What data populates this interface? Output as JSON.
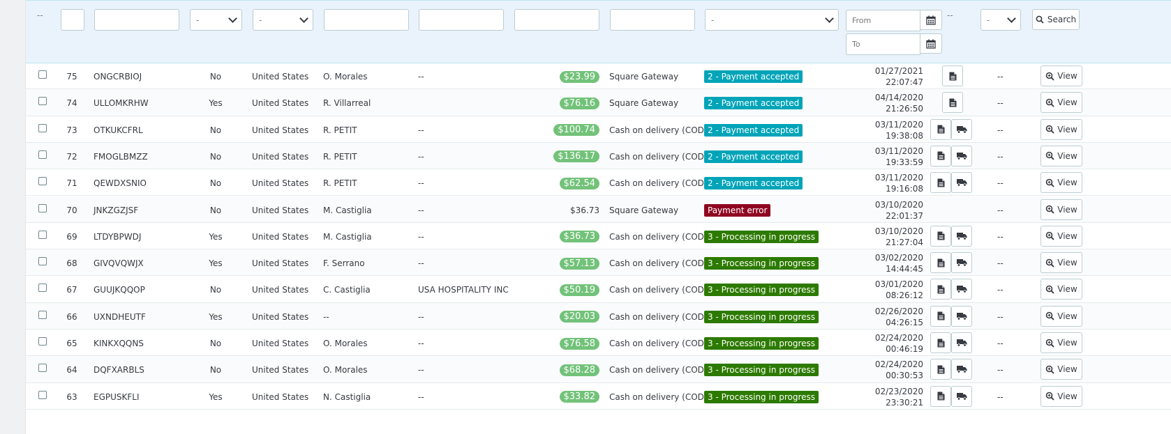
{
  "filters": {
    "checkbox_placeholder": "--",
    "new_client_select": "-",
    "country_select": "-",
    "status_select": "-",
    "date_from_placeholder": "From",
    "date_to_placeholder": "To",
    "pdf_placeholder": "--",
    "last_select": "-",
    "search_label": "Search"
  },
  "colors": {
    "price_badge": "#72c279",
    "payment_accepted": "#00a4b8",
    "payment_error": "#8f0621",
    "processing": "#2c7a00"
  },
  "icons": {
    "invoice": "file-text-icon",
    "delivery": "truck-icon",
    "view": "search-plus-icon",
    "calendar": "calendar-icon",
    "search": "search-icon"
  },
  "view_label": "View",
  "orders": [
    {
      "id": "75",
      "reference": "ONGCRBIOJ",
      "new_client": "No",
      "country": "United States",
      "customer": "O. Morales",
      "company": "--",
      "total": "$23.99",
      "total_badge": true,
      "payment": "Square Gateway",
      "status": "2 - Payment accepted",
      "status_type": "payment_accepted",
      "date": "01/27/2021",
      "time": "22:07:47",
      "invoice": true,
      "delivery": false,
      "pdf_dash": "--"
    },
    {
      "id": "74",
      "reference": "ULLOMKRHW",
      "new_client": "Yes",
      "country": "United States",
      "customer": "R. Villarreal",
      "company": "",
      "total": "$76.16",
      "total_badge": true,
      "payment": "Square Gateway",
      "status": "2 - Payment accepted",
      "status_type": "payment_accepted",
      "date": "04/14/2020",
      "time": "21:26:50",
      "invoice": true,
      "delivery": false,
      "pdf_dash": "--"
    },
    {
      "id": "73",
      "reference": "OTKUKCFRL",
      "new_client": "No",
      "country": "United States",
      "customer": "R. PETIT",
      "company": "--",
      "total": "$100.74",
      "total_badge": true,
      "payment": "Cash on delivery (COD)",
      "status": "2 - Payment accepted",
      "status_type": "payment_accepted",
      "date": "03/11/2020",
      "time": "19:38:08",
      "invoice": true,
      "delivery": true,
      "pdf_dash": "--"
    },
    {
      "id": "72",
      "reference": "FMOGLBMZZ",
      "new_client": "No",
      "country": "United States",
      "customer": "R. PETIT",
      "company": "--",
      "total": "$136.17",
      "total_badge": true,
      "payment": "Cash on delivery (COD)",
      "status": "2 - Payment accepted",
      "status_type": "payment_accepted",
      "date": "03/11/2020",
      "time": "19:33:59",
      "invoice": true,
      "delivery": true,
      "pdf_dash": "--"
    },
    {
      "id": "71",
      "reference": "QEWDXSNIO",
      "new_client": "No",
      "country": "United States",
      "customer": "R. PETIT",
      "company": "--",
      "total": "$62.54",
      "total_badge": true,
      "payment": "Cash on delivery (COD)",
      "status": "2 - Payment accepted",
      "status_type": "payment_accepted",
      "date": "03/11/2020",
      "time": "19:16:08",
      "invoice": true,
      "delivery": true,
      "pdf_dash": "--"
    },
    {
      "id": "70",
      "reference": "JNKZGZJSF",
      "new_client": "No",
      "country": "United States",
      "customer": "M. Castiglia",
      "company": "--",
      "total": "$36.73",
      "total_badge": false,
      "payment": "Square Gateway",
      "status": "Payment error",
      "status_type": "payment_error",
      "date": "03/10/2020",
      "time": "22:01:37",
      "invoice": false,
      "delivery": false,
      "pdf_dash": "--"
    },
    {
      "id": "69",
      "reference": "LTDYBPWDJ",
      "new_client": "Yes",
      "country": "United States",
      "customer": "M. Castiglia",
      "company": "--",
      "total": "$36.73",
      "total_badge": true,
      "payment": "Cash on delivery (COD)",
      "status": "3 - Processing in progress",
      "status_type": "processing",
      "date": "03/10/2020",
      "time": "21:27:04",
      "invoice": true,
      "delivery": true,
      "pdf_dash": "--"
    },
    {
      "id": "68",
      "reference": "GIVQVQWJX",
      "new_client": "Yes",
      "country": "United States",
      "customer": "F. Serrano",
      "company": "--",
      "total": "$57.13",
      "total_badge": true,
      "payment": "Cash on delivery (COD)",
      "status": "3 - Processing in progress",
      "status_type": "processing",
      "date": "03/02/2020",
      "time": "14:44:45",
      "invoice": true,
      "delivery": true,
      "pdf_dash": "--"
    },
    {
      "id": "67",
      "reference": "GUUJKQQOP",
      "new_client": "No",
      "country": "United States",
      "customer": "C. Castiglia",
      "company": "USA HOSPITALITY INC",
      "total": "$50.19",
      "total_badge": true,
      "payment": "Cash on delivery (COD)",
      "status": "3 - Processing in progress",
      "status_type": "processing",
      "date": "03/01/2020",
      "time": "08:26:12",
      "invoice": true,
      "delivery": true,
      "pdf_dash": "--"
    },
    {
      "id": "66",
      "reference": "UXNDHEUTF",
      "new_client": "Yes",
      "country": "United States",
      "customer": "--",
      "company": "--",
      "total": "$20.03",
      "total_badge": true,
      "payment": "Cash on delivery (COD)",
      "status": "3 - Processing in progress",
      "status_type": "processing",
      "date": "02/26/2020",
      "time": "04:26:15",
      "invoice": true,
      "delivery": true,
      "pdf_dash": "--"
    },
    {
      "id": "65",
      "reference": "KINKXQQNS",
      "new_client": "No",
      "country": "United States",
      "customer": "O. Morales",
      "company": "--",
      "total": "$76.58",
      "total_badge": true,
      "payment": "Cash on delivery (COD)",
      "status": "3 - Processing in progress",
      "status_type": "processing",
      "date": "02/24/2020",
      "time": "00:46:19",
      "invoice": true,
      "delivery": true,
      "pdf_dash": "--"
    },
    {
      "id": "64",
      "reference": "DQFXARBLS",
      "new_client": "No",
      "country": "United States",
      "customer": "O. Morales",
      "company": "--",
      "total": "$68.28",
      "total_badge": true,
      "payment": "Cash on delivery (COD)",
      "status": "3 - Processing in progress",
      "status_type": "processing",
      "date": "02/24/2020",
      "time": "00:30:53",
      "invoice": true,
      "delivery": true,
      "pdf_dash": "--"
    },
    {
      "id": "63",
      "reference": "EGPUSKFLI",
      "new_client": "Yes",
      "country": "United States",
      "customer": "N. Castiglia",
      "company": "--",
      "total": "$33.82",
      "total_badge": true,
      "payment": "Cash on delivery (COD)",
      "status": "3 - Processing in progress",
      "status_type": "processing",
      "date": "02/23/2020",
      "time": "23:30:21",
      "invoice": true,
      "delivery": true,
      "pdf_dash": "--"
    }
  ]
}
